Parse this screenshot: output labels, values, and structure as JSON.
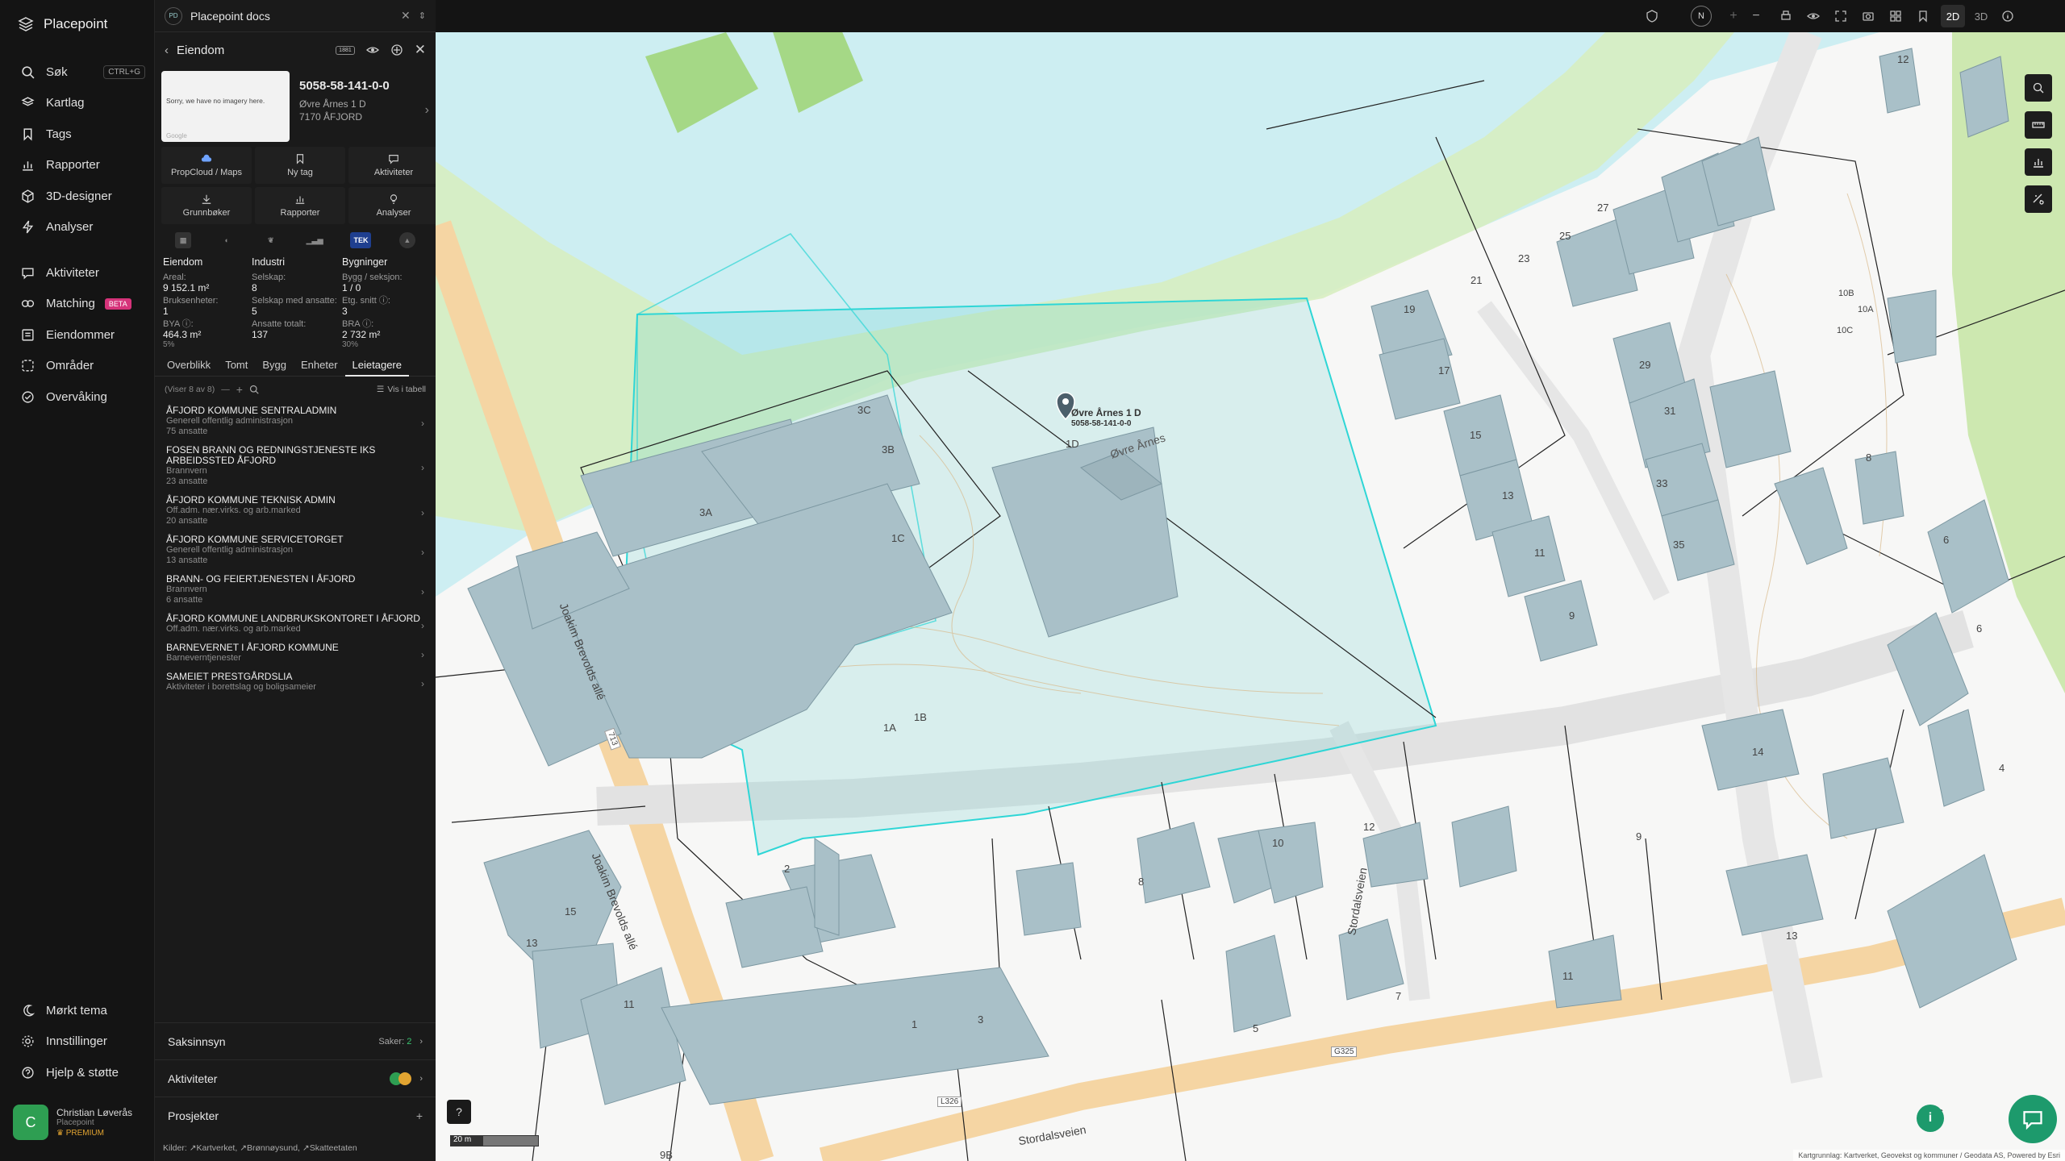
{
  "app": {
    "name": "Placepoint"
  },
  "nav": {
    "items": [
      {
        "label": "Søk",
        "icon": "search-icon",
        "shortcut": "CTRL+G"
      },
      {
        "label": "Kartlag",
        "icon": "layers-icon"
      },
      {
        "label": "Tags",
        "icon": "bookmark-icon"
      },
      {
        "label": "Rapporter",
        "icon": "chart-icon"
      },
      {
        "label": "3D-designer",
        "icon": "cube-icon"
      },
      {
        "label": "Analyser",
        "icon": "bolt-icon"
      },
      {
        "label": "Aktiviteter",
        "icon": "chat-icon"
      },
      {
        "label": "Matching",
        "icon": "match-icon",
        "badge": "BETA"
      },
      {
        "label": "Eiendommer",
        "icon": "list-icon"
      },
      {
        "label": "Områder",
        "icon": "area-icon"
      },
      {
        "label": "Overvåking",
        "icon": "eye-icon"
      }
    ],
    "bottom": [
      {
        "label": "Mørkt tema",
        "icon": "moon-icon"
      },
      {
        "label": "Innstillinger",
        "icon": "gear-icon"
      },
      {
        "label": "Hjelp & støtte",
        "icon": "help-icon"
      }
    ],
    "user": {
      "initial": "C",
      "name": "Christian Løverås",
      "org": "Placepoint",
      "plan": "PREMIUM"
    }
  },
  "panel": {
    "doc_badge": "PD",
    "doc_title": "Placepoint docs",
    "header": {
      "title": "Eiendom"
    },
    "property": {
      "id": "5058-58-141-0-0",
      "address": "Øvre Årnes 1 D",
      "postal": "7170 ÅFJORD",
      "imagery_text": "Sorry, we have no imagery here.",
      "imagery_credit": "Google"
    },
    "actions": [
      {
        "label": "PropCloud / Maps",
        "icon": "cloud-icon"
      },
      {
        "label": "Ny tag",
        "icon": "bookmark-icon"
      },
      {
        "label": "Aktiviteter",
        "icon": "chat-icon"
      },
      {
        "label": "Grunnbøker",
        "icon": "download-icon"
      },
      {
        "label": "Rapporter",
        "icon": "chart-icon"
      },
      {
        "label": "Analyser",
        "icon": "bolt-icon"
      }
    ],
    "strip_tek": "TEK",
    "stats": {
      "eiendom": {
        "title": "Eiendom",
        "areal_label": "Areal:",
        "areal": "9 152.1 m²",
        "bruks_label": "Bruksenheter:",
        "bruks": "1",
        "bya_label": "BYA ⓘ:",
        "bya": "464.3 m²",
        "bya_pct": "5%"
      },
      "industri": {
        "title": "Industri",
        "selskap_label": "Selskap:",
        "selskap": "8",
        "ansatte_label": "Selskap med ansatte:",
        "ansatte": "5",
        "totalt_label": "Ansatte totalt:",
        "totalt": "137"
      },
      "bygninger": {
        "title": "Bygninger",
        "bygg_label": "Bygg / seksjon:",
        "bygg": "1 / 0",
        "etg_label": "Etg. snitt ⓘ:",
        "etg": "3",
        "bra_label": "BRA ⓘ:",
        "bra": "2 732 m²",
        "bra_pct": "30%"
      }
    },
    "tabs": [
      "Overblikk",
      "Tomt",
      "Bygg",
      "Enheter",
      "Leietagere"
    ],
    "filter": {
      "showing": "(Viser 8 av 8)",
      "table_label": "Vis i tabell"
    },
    "tenants": [
      {
        "name": "ÅFJORD KOMMUNE SENTRALADMIN",
        "category": "Generell offentlig administrasjon",
        "count": "75 ansatte"
      },
      {
        "name": "FOSEN BRANN OG REDNINGSTJENESTE IKS ARBEIDSSTED ÅFJORD",
        "category": "Brannvern",
        "count": "23 ansatte"
      },
      {
        "name": "ÅFJORD KOMMUNE TEKNISK ADMIN",
        "category": "Off.adm. nær.virks. og arb.marked",
        "count": "20 ansatte"
      },
      {
        "name": "ÅFJORD KOMMUNE SERVICETORGET",
        "category": "Generell offentlig administrasjon",
        "count": "13 ansatte"
      },
      {
        "name": "BRANN- OG FEIERTJENESTEN I ÅFJORD",
        "category": "Brannvern",
        "count": "6 ansatte"
      },
      {
        "name": "ÅFJORD KOMMUNE LANDBRUKSKONTORET I ÅFJORD",
        "category": "Off.adm. nær.virks. og arb.marked",
        "count": ""
      },
      {
        "name": "BARNEVERNET I ÅFJORD KOMMUNE",
        "category": "Barneverntjenester",
        "count": ""
      },
      {
        "name": "SAMEIET PRESTGÅRDSLIA",
        "category": "Aktiviteter i borettslag og boligsameier",
        "count": ""
      }
    ],
    "accordions": {
      "saksinnsyn": {
        "label": "Saksinnsyn",
        "cases_label": "Saker:",
        "cases": "2"
      },
      "aktiviteter": {
        "label": "Aktiviteter"
      },
      "prosjekter": {
        "label": "Prosjekter"
      }
    },
    "sources_label": "Kilder:",
    "sources": [
      "Kartverket",
      "Brønnøysund",
      "Skatteetaten"
    ]
  },
  "map": {
    "view_2d": "2D",
    "view_3d": "3D",
    "north": "N",
    "scale": "20 m",
    "attribution": "Kartgrunnlag: Kartverket, Geovekst og kommuner / Geodata AS, Powered by Esri",
    "marker": {
      "label": "Øvre Årnes 1 D",
      "sub": "5058-58-141-0-0"
    },
    "street_labels": {
      "joakim1": "Joakim Brevolds allé",
      "joakim2": "Joakim Brevolds allé",
      "ovre": "Øvre Årnes",
      "stordal1": "Stordalsveien",
      "stordal2": "Stordalsveien",
      "road_713": "713",
      "road_g325": "G325",
      "road_l326": "L326"
    },
    "building_numbers": {
      "b1d": "1D",
      "b1c": "1C",
      "b1a": "1A",
      "b1b": "1B",
      "b3b": "3B",
      "b3a": "3A",
      "b3c": "3C",
      "b2": "2",
      "b15": "15",
      "b13": "13",
      "b11w": "11",
      "b1s": "1",
      "b3s": "3",
      "b8s": "8",
      "b10": "10",
      "b12": "12",
      "b5": "5",
      "b7": "7",
      "b9m": "9",
      "b11m": "11",
      "b13e": "13",
      "b14": "14",
      "b6e": "6",
      "b4e": "4",
      "b6se": "6",
      "b9b": "9B",
      "b19": "19",
      "b17": "17",
      "b15n": "15",
      "b13n": "13",
      "b11n": "11",
      "b9n": "9",
      "b21": "21",
      "b23": "23",
      "b25": "25",
      "b27": "27",
      "b29": "29",
      "b31": "31",
      "b33": "33",
      "b35": "35",
      "b10b": "10B",
      "b10a": "10A",
      "b10c": "10C",
      "b8e": "8",
      "b6ne": "6",
      "b12ne": "12"
    },
    "colors": {
      "water": "#cdeef2",
      "building": "#a9c0c8",
      "building_stroke": "#7d98a2",
      "parcel": "#2ed6d6",
      "road": "#f5d5a3",
      "green": "#cde8b0",
      "field": "#a5d886"
    }
  }
}
